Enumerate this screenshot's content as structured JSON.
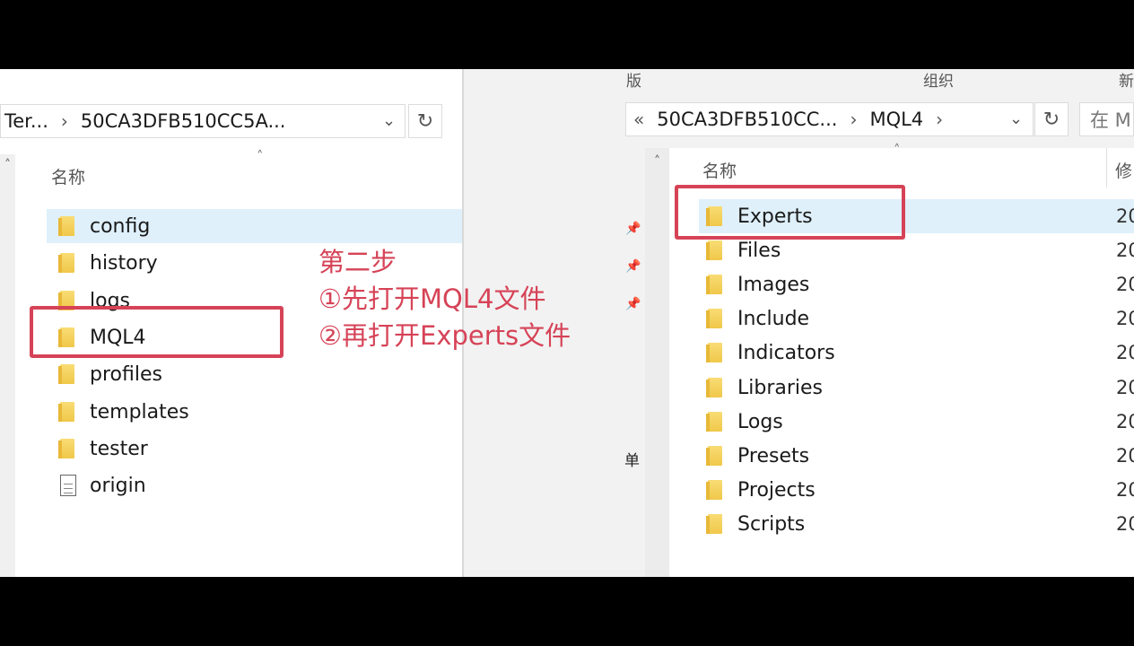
{
  "left": {
    "breadcrumb": [
      "Ter...",
      "50CA3DFB510CC5A..."
    ],
    "column_name": "名称",
    "items": [
      {
        "name": "config",
        "type": "folder",
        "selected": true
      },
      {
        "name": "history",
        "type": "folder"
      },
      {
        "name": "logs",
        "type": "folder"
      },
      {
        "name": "MQL4",
        "type": "folder",
        "highlighted": true
      },
      {
        "name": "profiles",
        "type": "folder"
      },
      {
        "name": "templates",
        "type": "folder"
      },
      {
        "name": "tester",
        "type": "folder"
      },
      {
        "name": "origin",
        "type": "file"
      }
    ]
  },
  "right": {
    "top_labels": [
      "版",
      "组织",
      "新"
    ],
    "breadcrumb_prefix": "«",
    "breadcrumb": [
      "50CA3DFB510CC...",
      "MQL4"
    ],
    "search_placeholder": "在 M",
    "column_name": "名称",
    "column_modified": "修",
    "side_char": "单",
    "items": [
      {
        "name": "Experts",
        "date": "20",
        "selected": true,
        "highlighted": true
      },
      {
        "name": "Files",
        "date": "20"
      },
      {
        "name": "Images",
        "date": "20"
      },
      {
        "name": "Include",
        "date": "20"
      },
      {
        "name": "Indicators",
        "date": "20"
      },
      {
        "name": "Libraries",
        "date": "20"
      },
      {
        "name": "Logs",
        "date": "20"
      },
      {
        "name": "Presets",
        "date": "20"
      },
      {
        "name": "Projects",
        "date": "20"
      },
      {
        "name": "Scripts",
        "date": "20"
      }
    ]
  },
  "annotation": {
    "line1": "第二步",
    "line2": "①先打开MQL4文件",
    "line3": "②再打开Experts文件"
  },
  "colors": {
    "highlight": "#d64357",
    "selection": "#dff0fb"
  },
  "icons": {
    "dropdown": "chevron-down-icon",
    "refresh": "refresh-icon",
    "folder": "folder-icon",
    "file": "file-icon",
    "pin": "pin-icon"
  }
}
